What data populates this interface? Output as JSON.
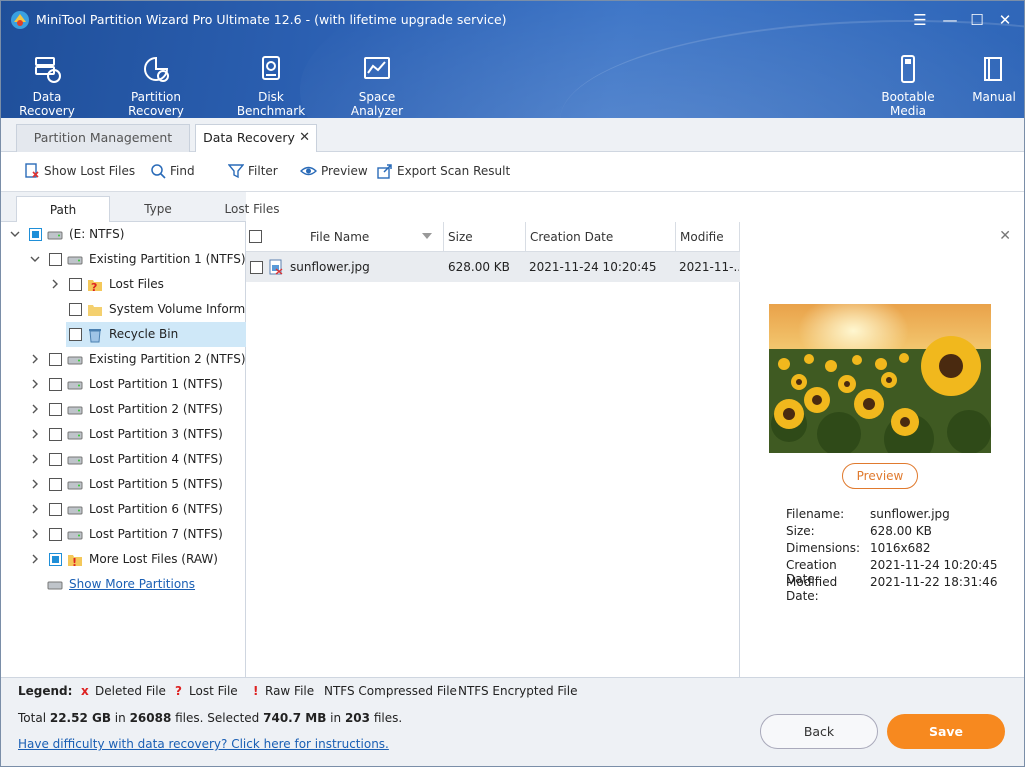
{
  "window": {
    "title": "MiniTool Partition Wizard Pro Ultimate 12.6 - (with lifetime upgrade service)",
    "controls": [
      "menu-icon",
      "minimize-icon",
      "maximize-icon",
      "close-icon"
    ]
  },
  "toolbar": {
    "items": [
      {
        "label": "Data Recovery",
        "icon": "data-recovery-icon"
      },
      {
        "label": "Partition Recovery",
        "icon": "partition-recovery-icon"
      },
      {
        "label": "Disk Benchmark",
        "icon": "disk-benchmark-icon"
      },
      {
        "label": "Space Analyzer",
        "icon": "space-analyzer-icon"
      },
      {
        "label": "Bootable Media",
        "icon": "bootable-media-icon"
      },
      {
        "label": "Manual",
        "icon": "manual-icon"
      }
    ]
  },
  "main_tabs": [
    {
      "label": "Partition Management",
      "active": false
    },
    {
      "label": "Data Recovery",
      "active": true
    }
  ],
  "actions": [
    {
      "label": "Show Lost Files",
      "icon": "show-lost-files-icon"
    },
    {
      "label": "Find",
      "icon": "search-icon"
    },
    {
      "label": "Filter",
      "icon": "filter-icon"
    },
    {
      "label": "Preview",
      "icon": "eye-icon"
    },
    {
      "label": "Export Scan Result",
      "icon": "export-icon"
    }
  ],
  "sub_tabs": [
    {
      "label": "Path",
      "active": true
    },
    {
      "label": "Type",
      "active": false
    },
    {
      "label": "Lost Files",
      "active": false
    }
  ],
  "tree": {
    "root": "(E: NTFS)",
    "items": [
      {
        "label": "Existing Partition 1 (NTFS)",
        "level": 1,
        "expanded": true
      },
      {
        "label": "Lost Files",
        "level": 2,
        "expanded": false
      },
      {
        "label": "System Volume Inform...",
        "level": 2
      },
      {
        "label": "Recycle Bin",
        "level": 2,
        "selected": true
      },
      {
        "label": "Existing Partition 2 (NTFS)",
        "level": 1
      },
      {
        "label": "Lost Partition 1 (NTFS)",
        "level": 1
      },
      {
        "label": "Lost Partition 2 (NTFS)",
        "level": 1
      },
      {
        "label": "Lost Partition 3 (NTFS)",
        "level": 1
      },
      {
        "label": "Lost Partition 4 (NTFS)",
        "level": 1
      },
      {
        "label": "Lost Partition 5 (NTFS)",
        "level": 1
      },
      {
        "label": "Lost Partition 6 (NTFS)",
        "level": 1
      },
      {
        "label": "Lost Partition 7 (NTFS)",
        "level": 1
      },
      {
        "label": "More Lost Files (RAW)",
        "level": 1
      }
    ],
    "show_more": "Show More Partitions"
  },
  "file_list": {
    "columns": [
      "File Name",
      "Size",
      "Creation Date",
      "Modifie"
    ],
    "rows": [
      {
        "name": "sunflower.jpg",
        "size": "628.00 KB",
        "created": "2021-11-24 10:20:45",
        "modified": "2021-11-..."
      }
    ]
  },
  "preview": {
    "button": "Preview",
    "info": [
      {
        "key": "Filename:",
        "value": "sunflower.jpg"
      },
      {
        "key": "Size:",
        "value": "628.00 KB"
      },
      {
        "key": "Dimensions:",
        "value": "1016x682"
      },
      {
        "key": "Creation Date:",
        "value": "2021-11-24 10:20:45"
      },
      {
        "key": "Modified Date:",
        "value": "2021-11-22 18:31:46"
      }
    ]
  },
  "legend": {
    "title": "Legend:",
    "deleted_mark": "x",
    "deleted": "Deleted File",
    "lost_mark": "?",
    "lost": "Lost File",
    "raw_mark": "!",
    "raw": "Raw File",
    "compressed": "NTFS Compressed File",
    "encrypted": "NTFS Encrypted File"
  },
  "footer": {
    "total_prefix": "Total ",
    "total_size": "22.52 GB",
    "in1": " in ",
    "total_files": "26088",
    "files_selected": " files.  Selected ",
    "selected_size": "740.7 MB",
    "in2": " in ",
    "selected_files": "203",
    "files_end": " files.",
    "help": "Have difficulty with data recovery? Click here for instructions.",
    "back": "Back",
    "save": "Save"
  },
  "colors": {
    "header_blue": "#2d62b5",
    "accent_orange": "#f7891f",
    "selection_blue": "#cfe8f8",
    "checkbox_blue": "#1f8fd8"
  }
}
